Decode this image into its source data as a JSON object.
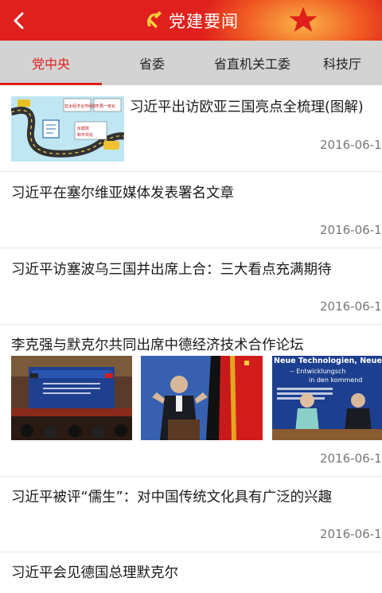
{
  "header": {
    "title": "党建要闻",
    "back_icon": "chevron-left-icon",
    "emblem_icon": "hammer-sickle-icon",
    "star_icon": "star-icon",
    "accent_color": "#e0201c"
  },
  "tabs": [
    {
      "label": "党中央",
      "active": true
    },
    {
      "label": "省委",
      "active": false
    },
    {
      "label": "省直机关工委",
      "active": false
    },
    {
      "label": "科技厅",
      "active": false
    }
  ],
  "news": [
    {
      "title": "习近平出访欧亚三国亮点全梳理(图解)",
      "date": "2016-06-1",
      "thumb_texts": [
        "亚太经济合作组织",
        "不再一体化",
        "反腐败",
        "和平共处"
      ]
    },
    {
      "title": "习近平在塞尔维亚媒体发表署名文章",
      "date": "2016-06-1"
    },
    {
      "title": "习近平访塞波乌三国并出席上合：三大看点充满期待",
      "date": "2016-06-1"
    },
    {
      "title": "李克强与默克尔共同出席中德经济技术合作论坛",
      "date": "2016-06-1",
      "photo3_texts": [
        "Neue Technologien, Neue Wi",
        "-- Entwicklungsch",
        "in den kommend"
      ]
    },
    {
      "title": "习近平被评“儒生”：对中国传统文化具有广泛的兴趣",
      "date": "2016-06-1"
    },
    {
      "title": "习近平会见德国总理默克尔"
    }
  ]
}
